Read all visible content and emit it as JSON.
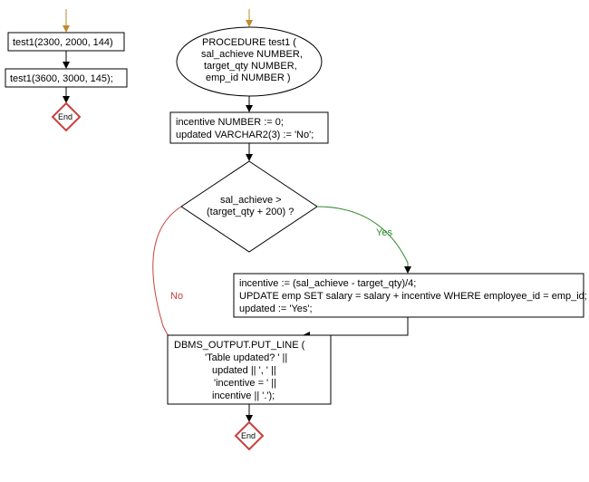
{
  "flow": {
    "call1": "test1(2300, 2000, 144)",
    "call2": "test1(3600, 3000, 145);",
    "end1": "End",
    "proc_header_l1": "PROCEDURE test1 (",
    "proc_header_l2": "sal_achieve NUMBER,",
    "proc_header_l3": "target_qty NUMBER,",
    "proc_header_l4": "emp_id NUMBER )",
    "decl_l1": "incentive NUMBER := 0;",
    "decl_l2": "updated  VARCHAR2(3) := 'No';",
    "cond_l1": "sal_achieve >",
    "cond_l2": "(target_qty + 200) ?",
    "yes_label": "Yes",
    "no_label": "No",
    "yes_block_l1": "incentive := (sal_achieve - target_qty)/4;",
    "yes_block_l2": "UPDATE emp SET salary = salary + incentive WHERE employee_id = emp_id;",
    "yes_block_l3": "updated := 'Yes';",
    "out_l1": "DBMS_OUTPUT.PUT_LINE (",
    "out_l2": "'Table updated?  ' ||",
    "out_l3": "updated || ', ' ||",
    "out_l4": "'incentive = ' ||",
    "out_l5": "incentive || '.');",
    "end2": "End"
  }
}
